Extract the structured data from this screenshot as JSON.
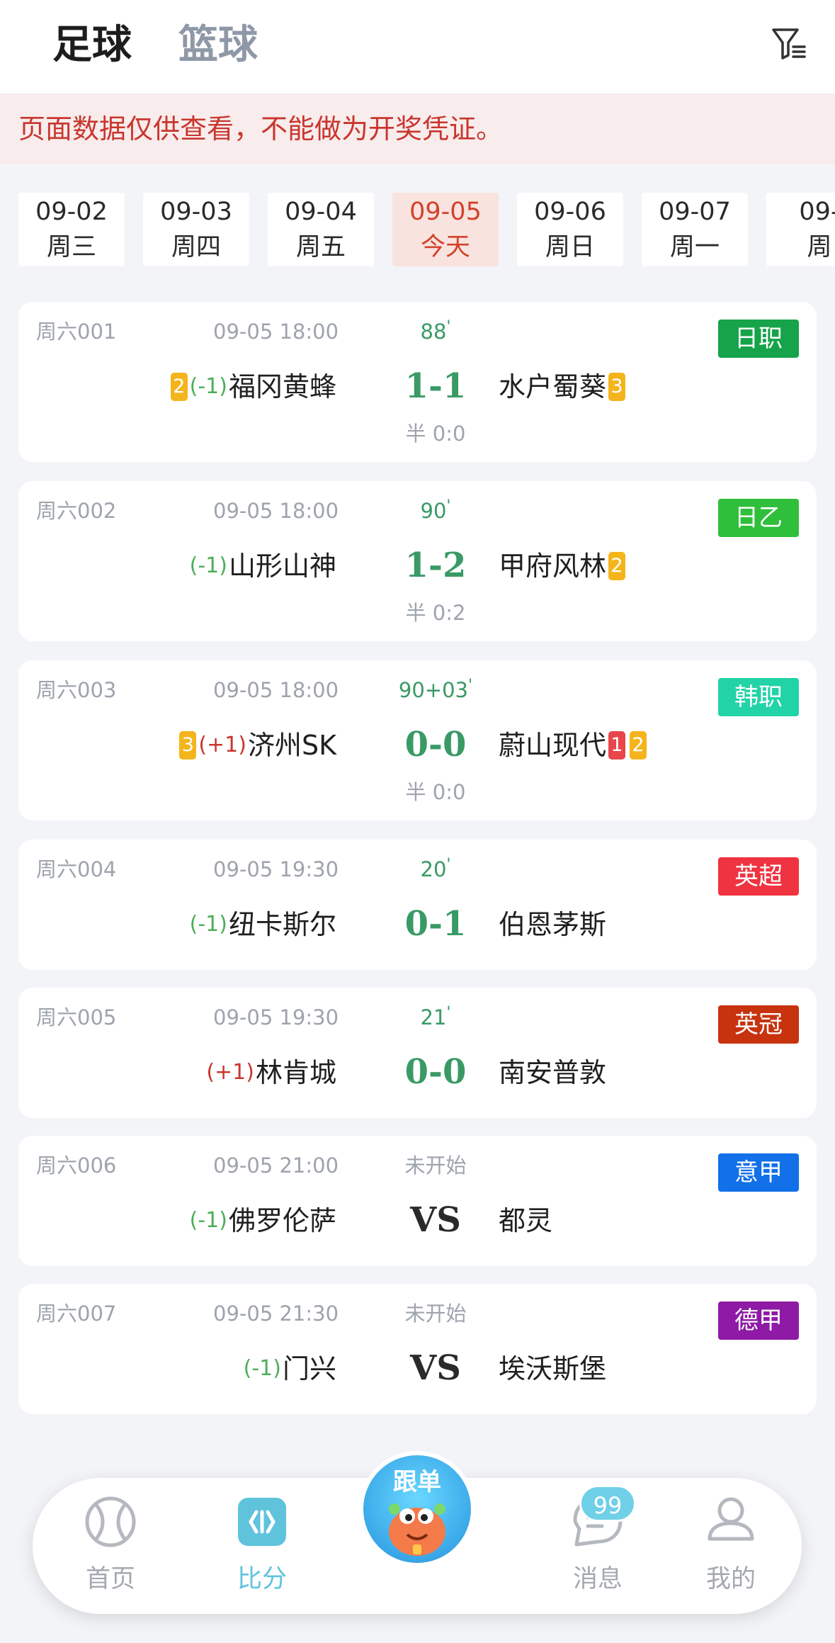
{
  "header": {
    "tabs": [
      {
        "label": "足球",
        "active": true
      },
      {
        "label": "篮球",
        "active": false
      }
    ],
    "filter_icon": "filter-icon"
  },
  "notice": "页面数据仅供查看，不能做为开奖凭证。",
  "dates": [
    {
      "date": "09-02",
      "day": "周三",
      "active": false
    },
    {
      "date": "09-03",
      "day": "周四",
      "active": false
    },
    {
      "date": "09-04",
      "day": "周五",
      "active": false
    },
    {
      "date": "09-05",
      "day": "今天",
      "active": true
    },
    {
      "date": "09-06",
      "day": "周日",
      "active": false
    },
    {
      "date": "09-07",
      "day": "周一",
      "active": false
    },
    {
      "date": "09-",
      "day": "周",
      "active": false
    }
  ],
  "matches": [
    {
      "id": "周六001",
      "time": "09-05 18:00",
      "status": "88",
      "status_prime": "'",
      "league": "日职",
      "league_color": "#16a34a",
      "home": "福冈黄蜂",
      "home_handicap": "(-1)",
      "home_badges": [
        "2"
      ],
      "score": "1-1",
      "away": "水户蜀葵",
      "away_badges": [
        "3"
      ],
      "half": "半 0:0"
    },
    {
      "id": "周六002",
      "time": "09-05 18:00",
      "status": "90",
      "status_prime": "'",
      "league": "日乙",
      "league_color": "#2fbf3a",
      "home": "山形山神",
      "home_handicap": "(-1)",
      "home_badges": [],
      "score": "1-2",
      "away": "甲府风林",
      "away_badges": [
        "2"
      ],
      "half": "半 0:2"
    },
    {
      "id": "周六003",
      "time": "09-05 18:00",
      "status": "90+03",
      "status_prime": "'",
      "league": "韩职",
      "league_color": "#22d3a7",
      "home": "济州SK",
      "home_handicap": "(+1)",
      "home_badges": [
        "3"
      ],
      "score": "0-0",
      "away": "蔚山现代",
      "away_red": "1",
      "away_badges": [
        "2"
      ],
      "half": "半 0:0"
    },
    {
      "id": "周六004",
      "time": "09-05 19:30",
      "status": "20",
      "status_prime": "'",
      "league": "英超",
      "league_color": "#ef3340",
      "home": "纽卡斯尔",
      "home_handicap": "(-1)",
      "home_badges": [],
      "score": "0-1",
      "away": "伯恩茅斯",
      "away_badges": [],
      "half": ""
    },
    {
      "id": "周六005",
      "time": "09-05 19:30",
      "status": "21",
      "status_prime": "'",
      "league": "英冠",
      "league_color": "#c7330f",
      "home": "林肯城",
      "home_handicap": "(+1)",
      "home_badges": [],
      "score": "0-0",
      "away": "南安普敦",
      "away_badges": [],
      "half": ""
    },
    {
      "id": "周六006",
      "time": "09-05 21:00",
      "status": "未开始",
      "status_prime": "",
      "league": "意甲",
      "league_color": "#1270e8",
      "home": "佛罗伦萨",
      "home_handicap": "(-1)",
      "home_badges": [],
      "score": "VS",
      "away": "都灵",
      "away_badges": [],
      "half": ""
    },
    {
      "id": "周六007",
      "time": "09-05 21:30",
      "status": "未开始",
      "status_prime": "",
      "league": "德甲",
      "league_color": "#8e1aa5",
      "home": "门兴",
      "home_handicap": "(-1)",
      "home_badges": [],
      "score": "VS",
      "away": "埃沃斯堡",
      "away_badges": [],
      "half": ""
    }
  ],
  "bottom_nav": {
    "items": [
      {
        "label": "首页",
        "icon": "football-icon",
        "active": false
      },
      {
        "label": "比分",
        "icon": "score-icon",
        "active": true
      },
      {
        "label": "跟单",
        "icon": "mascot-icon",
        "active": false
      },
      {
        "label": "消息",
        "icon": "message-icon",
        "active": false
      },
      {
        "label": "我的",
        "icon": "user-icon",
        "active": false
      }
    ],
    "message_count": "99"
  }
}
